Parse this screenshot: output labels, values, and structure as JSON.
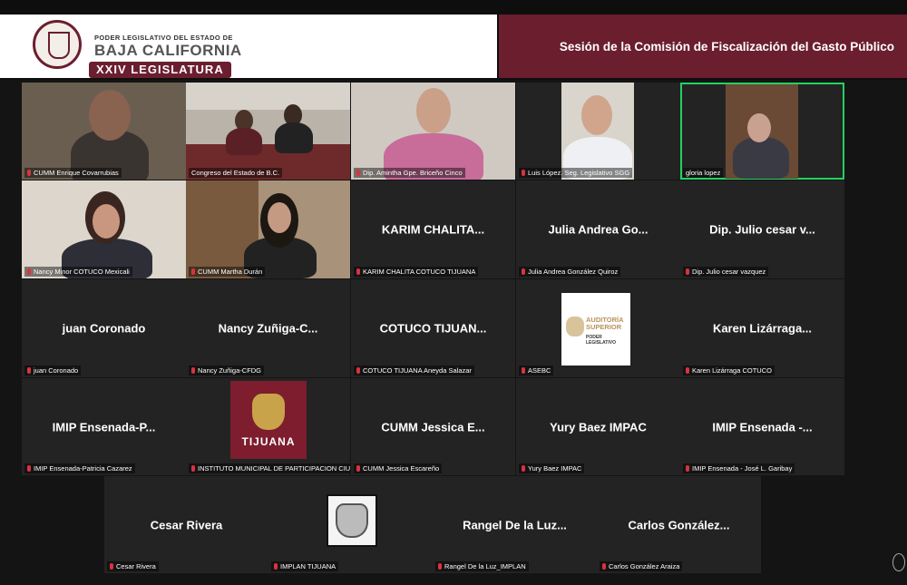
{
  "banner": {
    "logo_line1": "PODER LEGISLATIVO DEL ESTADO DE",
    "logo_line2": "BAJA CALIFORNIA",
    "logo_line3": "XXIV LEGISLATURA",
    "title": "Sesión de la Comisión de Fiscalización del Gasto Público"
  },
  "tiles": [
    {
      "label": "CUMM Enrique Covarrubias",
      "big": ""
    },
    {
      "label": "Congreso del Estado de B.C.",
      "big": ""
    },
    {
      "label": "Dip. Amintha Gpe. Briceño Cinco",
      "big": ""
    },
    {
      "label": "Luis López. Seg. Legislativo SGG",
      "big": ""
    },
    {
      "label": "gloria lopez",
      "big": ""
    },
    {
      "label": "Nancy Minor COTUCO Mexicali",
      "big": ""
    },
    {
      "label": "CUMM Martha Durán",
      "big": ""
    },
    {
      "label": "KARIM CHALITA COTUCO TIJUANA",
      "big": "KARIM  CHALITA..."
    },
    {
      "label": "Julia Andrea González Quiroz",
      "big": "Julia Andrea Go..."
    },
    {
      "label": "Dip. Julio cesar vazquez",
      "big": "Dip. Julio cesar v..."
    },
    {
      "label": "juan Coronado",
      "big": "juan Coronado"
    },
    {
      "label": "Nancy Zuñiga-CFDG",
      "big": "Nancy Zuñiga-C..."
    },
    {
      "label": "COTUCO TIJUANA Aneyda Salazar",
      "big": "COTUCO  TIJUAN..."
    },
    {
      "label": "ASEBC",
      "big": "",
      "logo_text": "AUDITORÍA SUPERIOR",
      "logo_sub": "PODER LEGISLATIVO"
    },
    {
      "label": "Karen Lizárraga COTUCO",
      "big": "Karen  Lizárraga..."
    },
    {
      "label": "IMIP Ensenada-Patricia Cazarez",
      "big": "IMIP  Ensenada-P..."
    },
    {
      "label": "INSTITUTO MUNICIPAL DE PARTICIPACION CIUDA...",
      "big": "",
      "logo_text": "TIJUANA"
    },
    {
      "label": "CUMM Jessica Escareño",
      "big": "CUMM  Jessica  E..."
    },
    {
      "label": "Yury Baez IMPAC",
      "big": "Yury Baez IMPAC"
    },
    {
      "label": "IMIP Ensenada - José L. Garibay",
      "big": "IMIP  Ensenada  -..."
    },
    {
      "label": "Cesar Rivera",
      "big": "Cesar Rivera"
    },
    {
      "label": "IMPLAN TIJUANA",
      "big": ""
    },
    {
      "label": "Rangel De la Luz_IMPLAN",
      "big": "Rangel De la Luz..."
    },
    {
      "label": "Carlos González Araiza",
      "big": "Carlos  González..."
    }
  ],
  "colors": {
    "brand": "#6b1e2e",
    "active_speaker": "#23d160",
    "muted_mic": "#d9333f"
  }
}
